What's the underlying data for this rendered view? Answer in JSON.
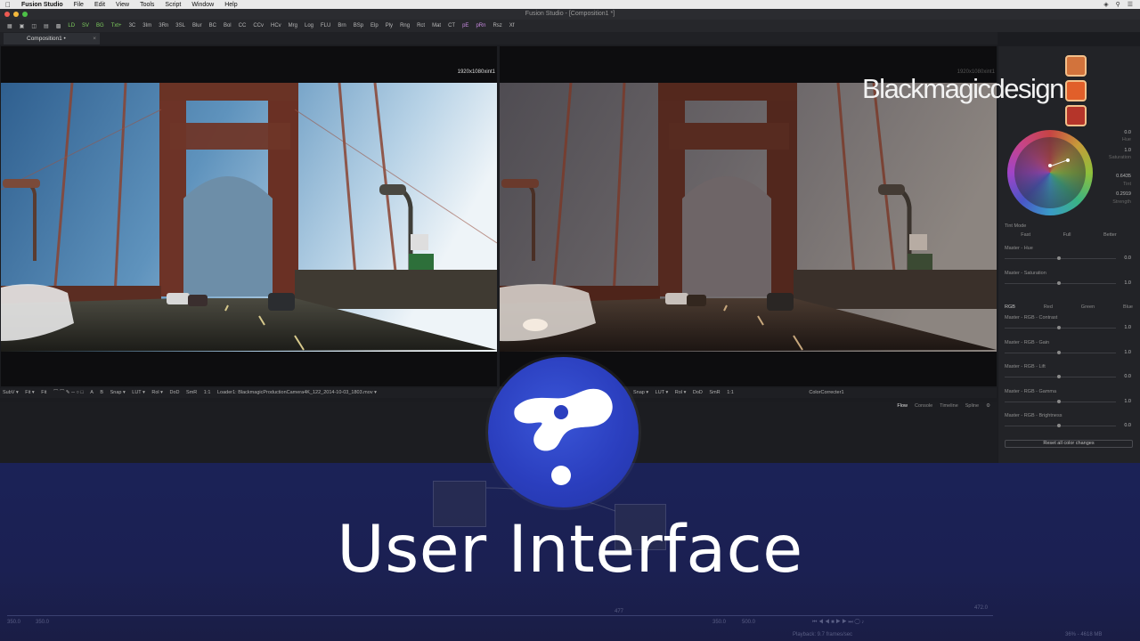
{
  "menubar": {
    "app_name": "Fusion Studio",
    "items": [
      "File",
      "Edit",
      "View",
      "Tools",
      "Script",
      "Window",
      "Help"
    ]
  },
  "window": {
    "title": "Fusion Studio - [Composition1 *]"
  },
  "toolbar": {
    "tools": [
      "LD",
      "SV",
      "BG",
      "Txt+",
      "3C",
      "3Im",
      "3Rn",
      "3SL",
      "Blur",
      "BC",
      "Bol",
      "CC",
      "CCv",
      "HCv",
      "Mrg",
      "Log",
      "FLU",
      "Brn",
      "BSp",
      "Elp",
      "Ply",
      "Rng",
      "Rct",
      "Mat",
      "CT",
      "pE",
      "pRn",
      "Rsz",
      "Xf"
    ]
  },
  "comp_tab": {
    "label": "Composition1 •",
    "close": "×"
  },
  "viewer_left": {
    "resolution": "1920x1080xint1",
    "toolbar": [
      "SubV ▾",
      "Fit ▾",
      "Fit",
      "A",
      "B",
      "Snap ▾",
      "LUT ▾",
      "Rol ▾",
      "DoD",
      "SmR",
      "1:1"
    ],
    "loader": "Loader1: BlackmagicProductionCamera4K_122_2014-10-03_1803.mov ▾"
  },
  "viewer_right": {
    "resolution": "1920x1080xint1",
    "toolbar": [
      "Snap ▾",
      "LUT ▾",
      "Rol ▾",
      "DoD",
      "SmR",
      "1:1"
    ],
    "node": "ColorCorrecter1"
  },
  "flow_tabs": [
    "Flow",
    "Console",
    "Timeline",
    "Spline"
  ],
  "inspector": {
    "tint_mode_label": "Tint Mode",
    "tint_modes": [
      "Fast",
      "Full",
      "Better"
    ],
    "wheel_values": [
      "0.0",
      "1.0",
      "0.6435",
      "0.2919"
    ],
    "wheel_labels": [
      "Hue",
      "Saturation",
      "Tint",
      "Strength"
    ],
    "hue": {
      "label": "Master - Hue",
      "value": "0.0",
      "pos": 0.47
    },
    "saturation": {
      "label": "Master - Saturation",
      "value": "1.0",
      "pos": 0.47
    },
    "channels": [
      "RGB",
      "Red",
      "Green",
      "Blue"
    ],
    "sliders": [
      {
        "label": "Master - RGB - Contrast",
        "value": "1.0",
        "pos": 0.47
      },
      {
        "label": "Master - RGB - Gain",
        "value": "1.0",
        "pos": 0.47
      },
      {
        "label": "Master - RGB - Lift",
        "value": "0.0",
        "pos": 0.47
      },
      {
        "label": "Master - RGB - Gamma",
        "value": "1.0",
        "pos": 0.47
      },
      {
        "label": "Master - RGB - Brightness",
        "value": "0.0",
        "pos": 0.47
      }
    ],
    "reset": "Reset all color changes"
  },
  "brand": {
    "text": "Blackmagicdesign"
  },
  "headline": "User Interface",
  "timeline": {
    "start": "350.0",
    "start2": "350.0",
    "current": "477",
    "end": "472.0",
    "render": "350.0",
    "render_end": "500.0",
    "playback": "Playback: 9.7 frames/sec",
    "memory": "36% - 4618 MB"
  },
  "colors": {
    "accent_orange": "#e8733a",
    "band": "#1b2257",
    "logo": "#2b3fbf"
  }
}
